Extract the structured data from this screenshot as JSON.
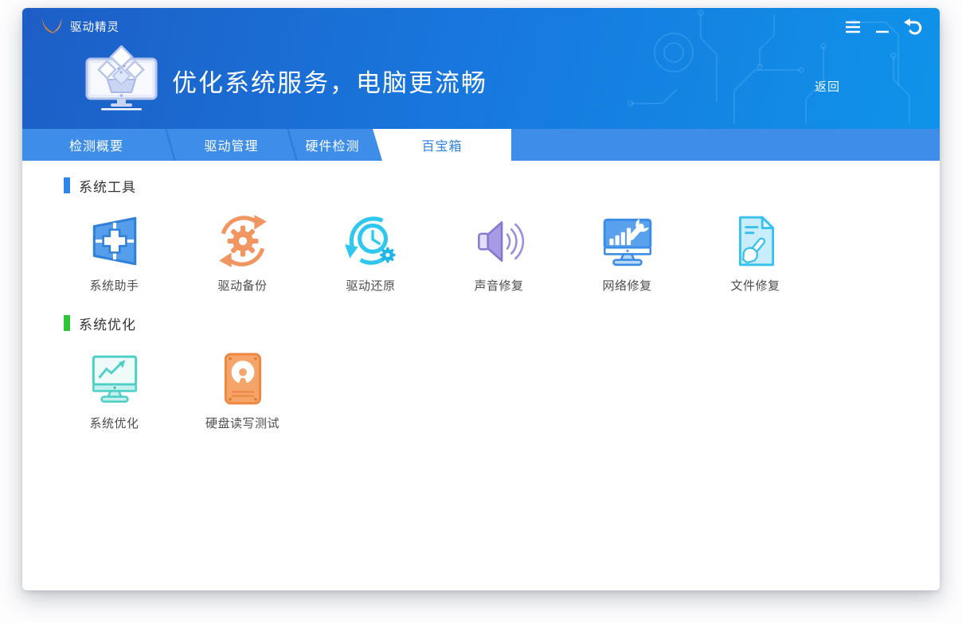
{
  "window": {
    "app_name": "驱动精灵",
    "controls": {
      "menu": "menu-icon",
      "minimize": "minimize-icon",
      "back": "back-arrow-icon"
    }
  },
  "header": {
    "title": "优化系统服务，电脑更流畅",
    "back_link": "返回",
    "banner_icon": "toolbox-monitor-icon"
  },
  "tabs": [
    {
      "label": "检测概要",
      "active": false
    },
    {
      "label": "驱动管理",
      "active": false
    },
    {
      "label": "硬件检测",
      "active": false
    },
    {
      "label": "百宝箱",
      "active": true
    }
  ],
  "sections": [
    {
      "title": "系统工具",
      "marker_color": "#2e86e8",
      "items": [
        {
          "label": "系统助手",
          "icon": "windows-plus-icon"
        },
        {
          "label": "驱动备份",
          "icon": "gear-sync-icon"
        },
        {
          "label": "驱动还原",
          "icon": "clock-restore-icon"
        },
        {
          "label": "声音修复",
          "icon": "speaker-waves-icon"
        },
        {
          "label": "网络修复",
          "icon": "monitor-wrench-icon"
        },
        {
          "label": "文件修复",
          "icon": "file-wrench-icon"
        }
      ]
    },
    {
      "title": "系统优化",
      "marker_color": "#2fc636",
      "items": [
        {
          "label": "系统优化",
          "icon": "monitor-chart-icon"
        },
        {
          "label": "硬盘读写测试",
          "icon": "hard-disk-icon"
        }
      ]
    }
  ],
  "colors": {
    "header_gradient_left": "#1d5ec6",
    "header_gradient_right": "#0f93ea",
    "tabbar_bg": "#3d8de9",
    "active_tab_bg": "#ffffff",
    "active_tab_text": "#2e81e2",
    "tab_text": "#ffffff",
    "section_tools_marker": "#2e86e8",
    "section_optimize_marker": "#2fc636",
    "icon_blue": "#3b8ce6",
    "icon_orange": "#f19661",
    "icon_cyan": "#2fc7ef",
    "icon_purple": "#a89ae5",
    "icon_teal": "#4fcfc5",
    "icon_file_cyan": "#36c1ee",
    "icon_hdd_orange": "#f6a56a"
  }
}
